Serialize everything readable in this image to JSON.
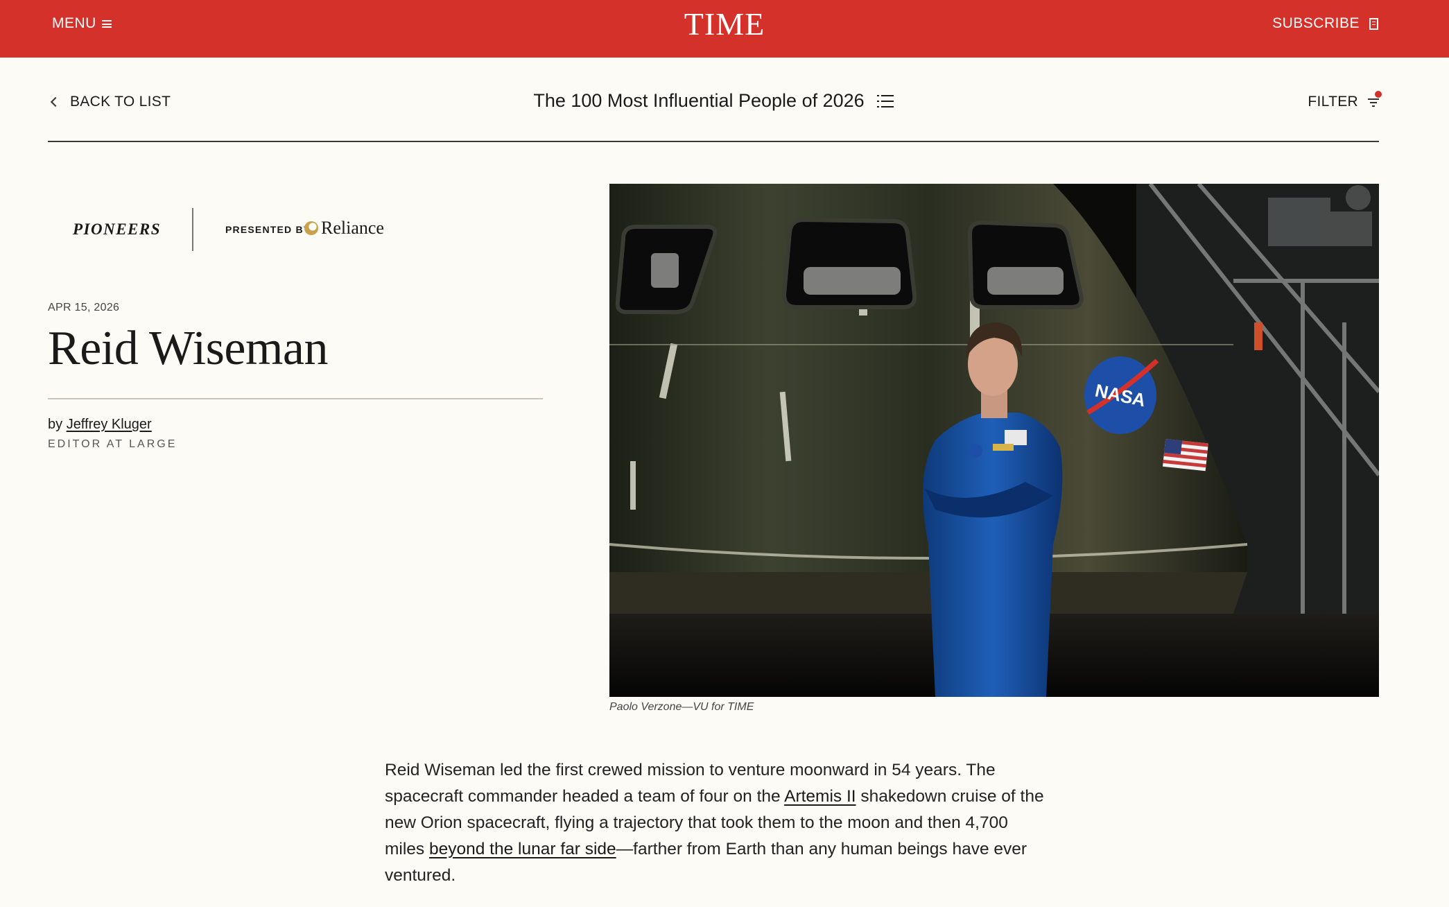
{
  "header": {
    "menu_label": "MENU",
    "logo_text": "TIME",
    "subscribe_label": "SUBSCRIBE",
    "brand_color": "#d4312b"
  },
  "subnav": {
    "back_label": "BACK TO LIST",
    "list_title": "The 100 Most Influential People of 2026",
    "filter_label": "FILTER",
    "filter_indicator_color": "#d4312b"
  },
  "category": {
    "name": "PIONEERS",
    "presented_by": "PRESENTED BY",
    "sponsor": "Reliance"
  },
  "article": {
    "date": "APR 15, 2026",
    "title": "Reid Wiseman",
    "byline_prefix": "by",
    "author": "Jeffrey Kluger",
    "author_role": "EDITOR AT LARGE",
    "photo_credit": "Paolo Verzone—VU for TIME",
    "photo_badge_text": "NASA",
    "body": {
      "p1_a": "Reid Wiseman led the first crewed mission to venture moonward in 54 years. The spacecraft commander headed a team of four on the ",
      "link1": "Artemis II",
      "p1_b": " shakedown cruise of the new Orion spacecraft, flying a trajectory that took them to the moon and then 4,700 miles ",
      "link2": "beyond the lunar far side",
      "p1_c": "—farther from Earth than any human beings have ever ventured."
    }
  }
}
